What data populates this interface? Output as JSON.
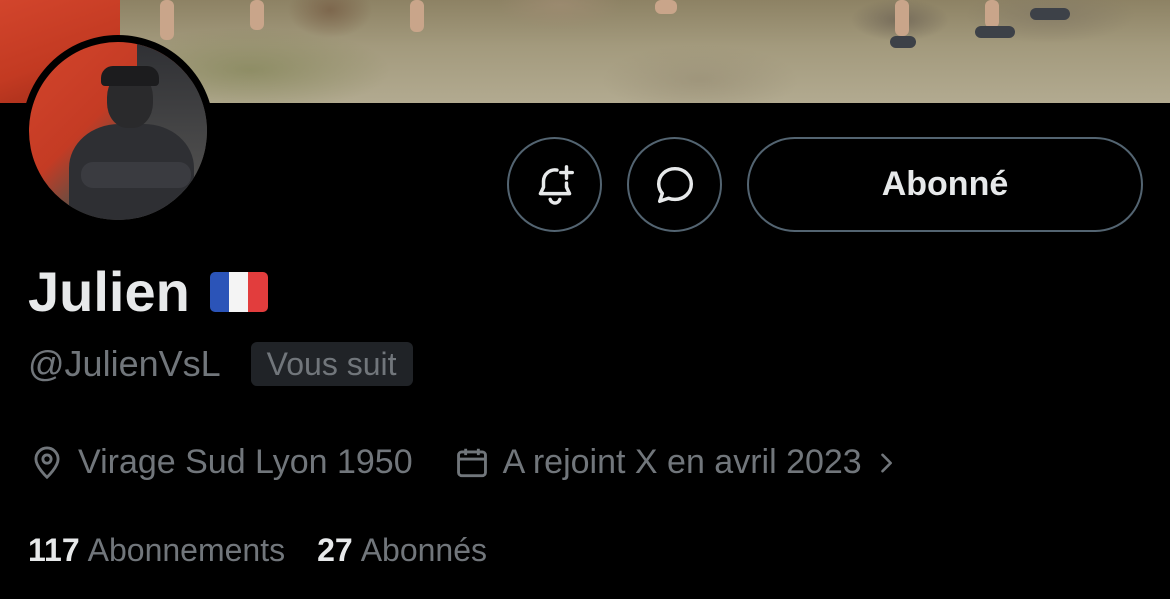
{
  "profile": {
    "display_name": "Julien",
    "flag_emoji": "🇫🇷",
    "handle": "@JulienVsL",
    "follows_you_badge": "Vous suit",
    "location": "Virage Sud Lyon 1950",
    "joined": "A rejoint X en avril 2023",
    "following_count": "117",
    "following_label": "Abonnements",
    "followers_count": "27",
    "followers_label": "Abonnés"
  },
  "actions": {
    "notifications_icon": "bell-plus-icon",
    "message_icon": "message-bubble-icon",
    "follow_label": "Abonné"
  },
  "icons": {
    "location": "location-pin-icon",
    "calendar": "calendar-icon",
    "chevron": "chevron-right-icon"
  },
  "colors": {
    "background": "#000000",
    "primary_text": "#e7e9ea",
    "secondary_text": "#71767b",
    "button_border": "#536471",
    "badge_bg": "#202327"
  }
}
